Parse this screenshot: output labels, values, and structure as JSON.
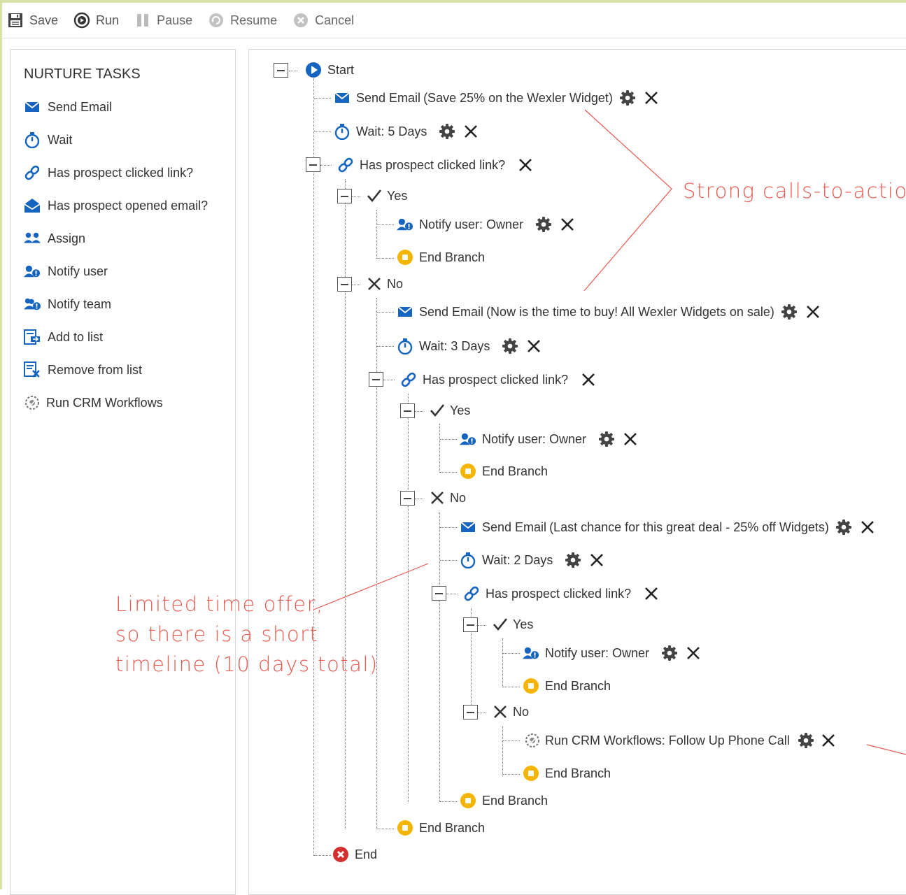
{
  "toolbar": {
    "save": "Save",
    "run": "Run",
    "pause": "Pause",
    "resume": "Resume",
    "cancel": "Cancel"
  },
  "sidebar": {
    "title": "NURTURE TASKS",
    "items": [
      "Send Email",
      "Wait",
      "Has prospect clicked link?",
      "Has prospect opened email?",
      "Assign",
      "Notify user",
      "Notify team",
      "Add to list",
      "Remove from list",
      "Run CRM Workflows"
    ]
  },
  "tree": {
    "start": "Start",
    "n1": "Send Email",
    "n1_detail": "(Save 25% on the Wexler Widget)",
    "n2": "Wait: 5 Days",
    "n3": "Has prospect clicked link?",
    "n4": "Yes",
    "n5": "Notify user: Owner",
    "n6": "End Branch",
    "n7": "No",
    "n8": "Send Email",
    "n8_detail": "(Now is the time to buy! All Wexler Widgets on sale)",
    "n9": "Wait: 3 Days",
    "n10": "Has prospect clicked link?",
    "n11": "Yes",
    "n12": "Notify user: Owner",
    "n13": "End Branch",
    "n14": "No",
    "n15": "Send Email",
    "n15_detail": "(Last chance for this great deal - 25% off Widgets)",
    "n16": "Wait: 2 Days",
    "n17": "Has prospect clicked link?",
    "n18": "Yes",
    "n19": "Notify user: Owner",
    "n20": "End Branch",
    "n21": "No",
    "n22": "Run CRM Workflows: Follow Up Phone Call",
    "n23": "End Branch",
    "n24": "End Branch",
    "n25": "End Branch",
    "end": "End"
  },
  "annotations": {
    "cta": "Strong calls-to-action",
    "timeline_1": "Limited time offer,",
    "timeline_2": "so there is a short",
    "timeline_3": "timeline (10 days total)"
  },
  "colors": {
    "accent": "#1565c0",
    "end_branch": "#f5b400",
    "end": "#d32f2f",
    "annotation": "#e8594e"
  },
  "icons": {
    "toolbar": [
      "save-icon",
      "run-icon",
      "pause-icon",
      "resume-icon",
      "cancel-icon"
    ],
    "tree": [
      "play-icon",
      "email-icon",
      "stopwatch-icon",
      "link-icon",
      "check-icon",
      "notify-user-icon",
      "stop-icon",
      "x-icon",
      "gear-icon",
      "delete-icon",
      "crm-workflow-icon",
      "end-icon"
    ]
  }
}
